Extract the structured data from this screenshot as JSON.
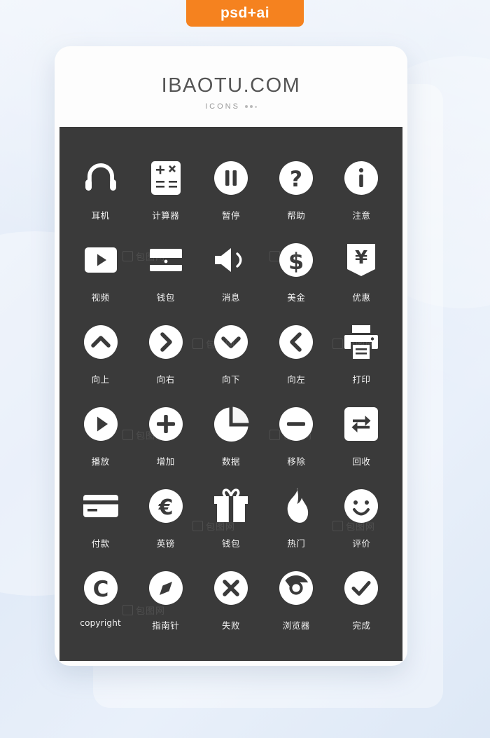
{
  "badge": {
    "label": "psd+ai",
    "color": "#f5821f"
  },
  "card": {
    "title": "IBAOTU.COM",
    "subtitle": "ICONS"
  },
  "panel": {
    "background": "#3a3a3a",
    "icon_color": "#ffffff",
    "watermark": "包图网"
  },
  "icons": [
    {
      "name": "headphone-icon",
      "label": "耳机"
    },
    {
      "name": "calculator-icon",
      "label": "计算器"
    },
    {
      "name": "pause-icon",
      "label": "暂停"
    },
    {
      "name": "help-icon",
      "label": "帮助"
    },
    {
      "name": "info-icon",
      "label": "注意"
    },
    {
      "name": "video-icon",
      "label": "视频"
    },
    {
      "name": "wallet-icon",
      "label": "钱包"
    },
    {
      "name": "message-icon",
      "label": "消息"
    },
    {
      "name": "dollar-icon",
      "label": "美金"
    },
    {
      "name": "yen-discount-icon",
      "label": "优惠"
    },
    {
      "name": "arrow-up-icon",
      "label": "向上"
    },
    {
      "name": "arrow-right-icon",
      "label": "向右"
    },
    {
      "name": "arrow-down-icon",
      "label": "向下"
    },
    {
      "name": "arrow-left-icon",
      "label": "向左"
    },
    {
      "name": "printer-icon",
      "label": "打印"
    },
    {
      "name": "play-icon",
      "label": "播放"
    },
    {
      "name": "plus-icon",
      "label": "增加"
    },
    {
      "name": "pie-chart-icon",
      "label": "数据"
    },
    {
      "name": "minus-icon",
      "label": "移除"
    },
    {
      "name": "recycle-icon",
      "label": "回收"
    },
    {
      "name": "credit-card-icon",
      "label": "付款"
    },
    {
      "name": "euro-icon",
      "label": "英镑"
    },
    {
      "name": "gift-icon",
      "label": "钱包"
    },
    {
      "name": "fire-icon",
      "label": "热门"
    },
    {
      "name": "smiley-icon",
      "label": "评价"
    },
    {
      "name": "copyright-icon",
      "label": "copyright"
    },
    {
      "name": "compass-icon",
      "label": "指南针"
    },
    {
      "name": "close-x-icon",
      "label": "失败"
    },
    {
      "name": "browser-icon",
      "label": "浏览器"
    },
    {
      "name": "check-icon",
      "label": "完成"
    }
  ]
}
